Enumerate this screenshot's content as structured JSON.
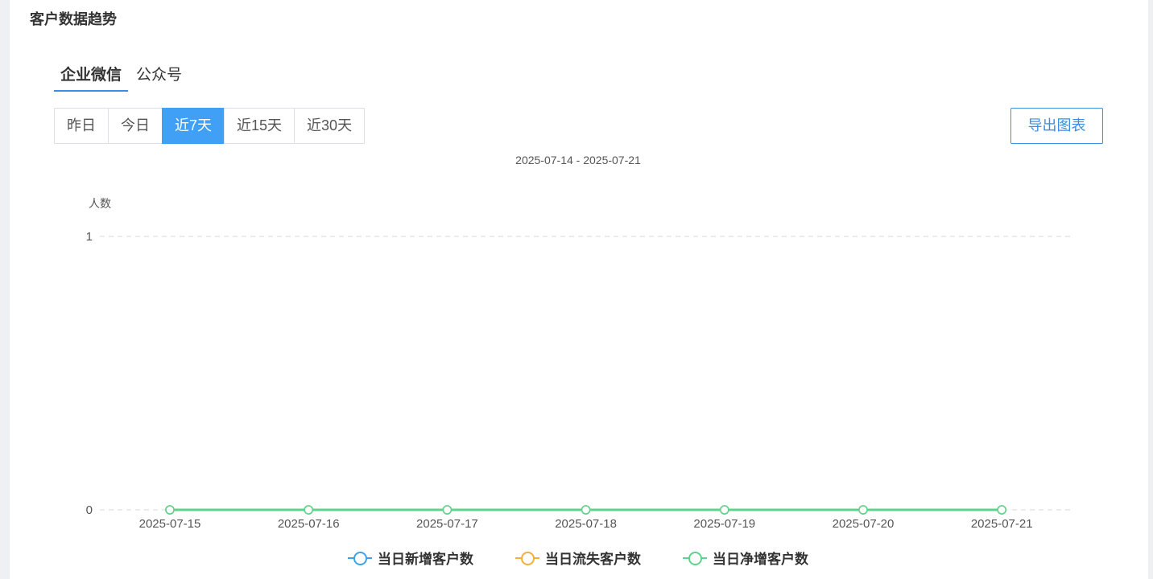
{
  "header": {
    "title": "客户数据趋势"
  },
  "tabs": [
    {
      "label": "企业微信",
      "active": true
    },
    {
      "label": "公众号",
      "active": false
    }
  ],
  "ranges": [
    {
      "label": "昨日",
      "active": false
    },
    {
      "label": "今日",
      "active": false
    },
    {
      "label": "近7天",
      "active": true
    },
    {
      "label": "近15天",
      "active": false
    },
    {
      "label": "近30天",
      "active": false
    }
  ],
  "export_label": "导出图表",
  "date_range": "2025-07-14 - 2025-07-21",
  "colors": {
    "accent": "#3fa0f5",
    "series_new": "#3ea2e6",
    "series_lost": "#f0b03f",
    "series_net": "#5fd38d"
  },
  "chart_data": {
    "type": "line",
    "ylabel": "人数",
    "ylim": [
      0,
      1
    ],
    "yticks": [
      "1",
      "0"
    ],
    "grid": true,
    "legend_position": "bottom",
    "x": [
      "2025-07-15",
      "2025-07-16",
      "2025-07-17",
      "2025-07-18",
      "2025-07-19",
      "2025-07-20",
      "2025-07-21"
    ],
    "series": [
      {
        "name": "当日新增客户数",
        "color": "#3ea2e6",
        "values": [
          0,
          0,
          0,
          0,
          0,
          0,
          0
        ]
      },
      {
        "name": "当日流失客户数",
        "color": "#f0b03f",
        "values": [
          0,
          0,
          0,
          0,
          0,
          0,
          0
        ]
      },
      {
        "name": "当日净增客户数",
        "color": "#5fd38d",
        "values": [
          0,
          0,
          0,
          0,
          0,
          0,
          0
        ]
      }
    ]
  }
}
